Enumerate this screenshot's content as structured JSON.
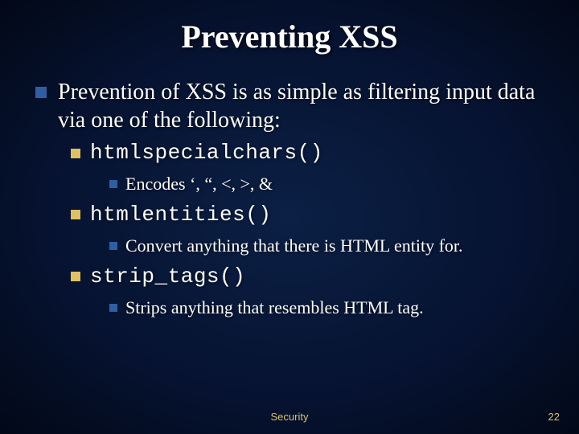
{
  "title": "Preventing XSS",
  "body": {
    "intro": "Prevention of XSS is as simple as filtering input data via one of the following:",
    "items": [
      {
        "fn": "htmlspecialchars()",
        "desc": "Encodes ‘, “, <, >, &"
      },
      {
        "fn": "htmlentities()",
        "desc": "Convert anything that there is HTML entity for."
      },
      {
        "fn": "strip_tags()",
        "desc": "Strips anything that resembles HTML tag."
      }
    ]
  },
  "footer": {
    "center": "Security",
    "page": "22"
  }
}
